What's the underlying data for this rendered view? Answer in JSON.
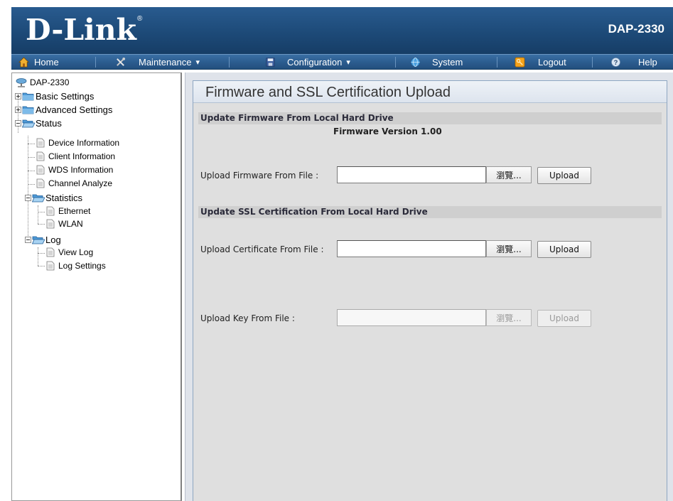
{
  "header": {
    "logo_text": "D-Link",
    "logo_mark": "®",
    "model": "DAP-2330"
  },
  "nav": {
    "items": [
      {
        "label": "Home",
        "icon": "home-icon",
        "dropdown": false
      },
      {
        "label": "Maintenance",
        "icon": "tools-icon",
        "dropdown": true
      },
      {
        "label": "Configuration",
        "icon": "save-disk-icon",
        "dropdown": true
      },
      {
        "label": "System",
        "icon": "globe-icon",
        "dropdown": false
      },
      {
        "label": "Logout",
        "icon": "key-icon",
        "dropdown": false
      },
      {
        "label": "Help",
        "icon": "help-icon",
        "dropdown": false
      }
    ],
    "dropdown_glyph": "▾"
  },
  "tree": {
    "root": "DAP-2330",
    "items": [
      {
        "label": "Basic Settings",
        "type": "folder",
        "state": "collapsed"
      },
      {
        "label": "Advanced Settings",
        "type": "folder",
        "state": "collapsed"
      },
      {
        "label": "Status",
        "type": "folder",
        "state": "expanded"
      },
      {
        "label": "Device Information",
        "type": "page"
      },
      {
        "label": "Client Information",
        "type": "page"
      },
      {
        "label": "WDS Information",
        "type": "page"
      },
      {
        "label": "Channel Analyze",
        "type": "page"
      },
      {
        "label": "Statistics",
        "type": "folder",
        "state": "expanded"
      },
      {
        "label": "Ethernet",
        "type": "page"
      },
      {
        "label": "WLAN",
        "type": "page"
      },
      {
        "label": "Log",
        "type": "folder",
        "state": "expanded"
      },
      {
        "label": "View Log",
        "type": "page"
      },
      {
        "label": "Log Settings",
        "type": "page"
      }
    ]
  },
  "main": {
    "title": "Firmware and SSL Certification Upload",
    "firmware_section": {
      "heading": "Update Firmware From Local Hard Drive",
      "version_text": "Firmware Version 1.00",
      "upload_label": "Upload Firmware From File :",
      "file_value": "",
      "browse_label": "瀏覽...",
      "upload_button": "Upload"
    },
    "ssl_section": {
      "heading": "Update SSL Certification From Local Hard Drive",
      "cert_label": "Upload Certificate From File :",
      "cert_value": "",
      "cert_browse": "瀏覽...",
      "cert_upload": "Upload",
      "key_label": "Upload Key From File :",
      "key_value": "",
      "key_browse": "瀏覽...",
      "key_upload": "Upload",
      "key_disabled": true
    }
  },
  "colors": {
    "header_blue": "#1d4a78",
    "nav_blue": "#2c5d90",
    "section_gray": "#cfcfcf",
    "content_bg": "#dfdfdf"
  }
}
